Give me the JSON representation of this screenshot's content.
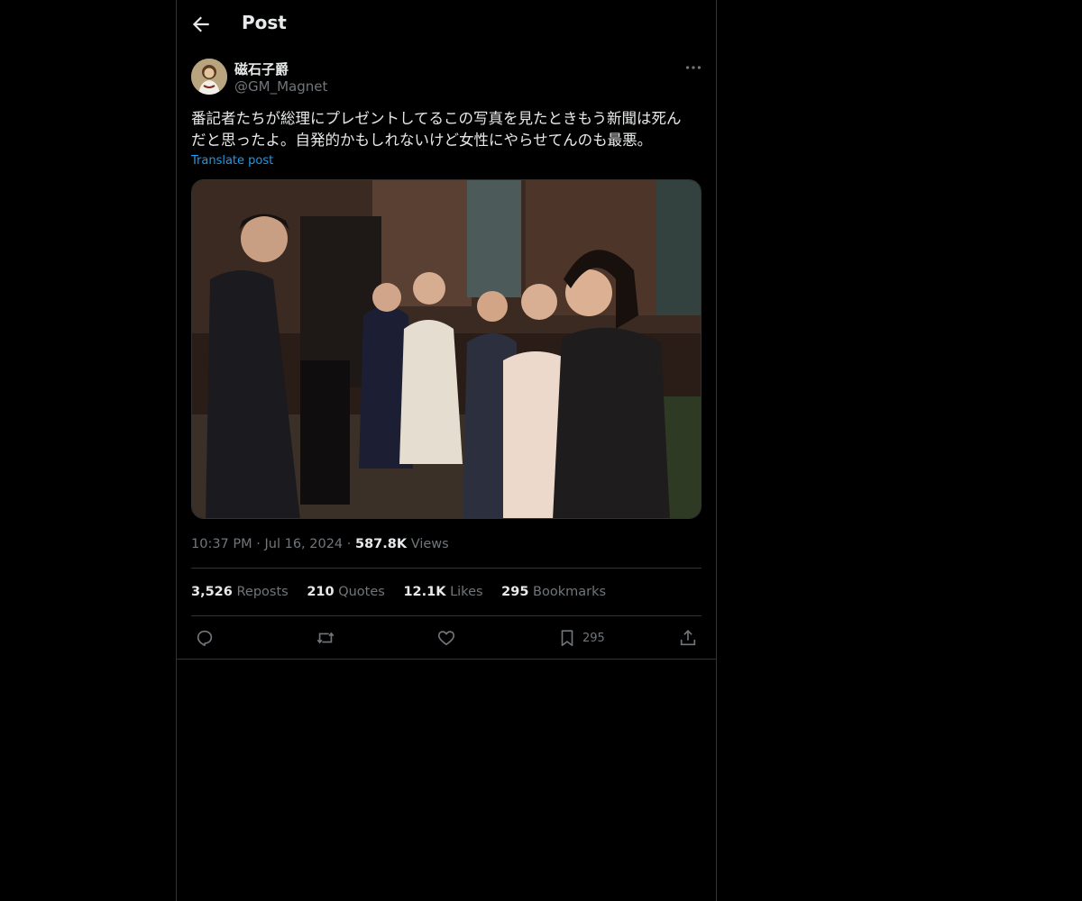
{
  "header": {
    "title": "Post"
  },
  "author": {
    "name": "磁石子爵",
    "handle": "@GM_Magnet"
  },
  "post": {
    "text_line1": "番記者たちが総理にプレゼントしてるこの写真を見たときもう新聞は死ん",
    "text_line2": "だと思ったよ。自発的かもしれないけど女性にやらせてんのも最悪。",
    "translate_label": "Translate post",
    "time": "10:37 PM",
    "date": "Jul 16, 2024",
    "views_count": "587.8K",
    "views_label": "Views"
  },
  "stats": [
    {
      "count": "3,526",
      "label": "Reposts"
    },
    {
      "count": "210",
      "label": "Quotes"
    },
    {
      "count": "12.1K",
      "label": "Likes"
    },
    {
      "count": "295",
      "label": "Bookmarks"
    }
  ],
  "actions": {
    "bookmark_count": "295"
  },
  "colors": {
    "background": "#000000",
    "text": "#e7e9ea",
    "muted": "#71767b",
    "accent": "#1d9bf0",
    "border": "#2f3336"
  }
}
